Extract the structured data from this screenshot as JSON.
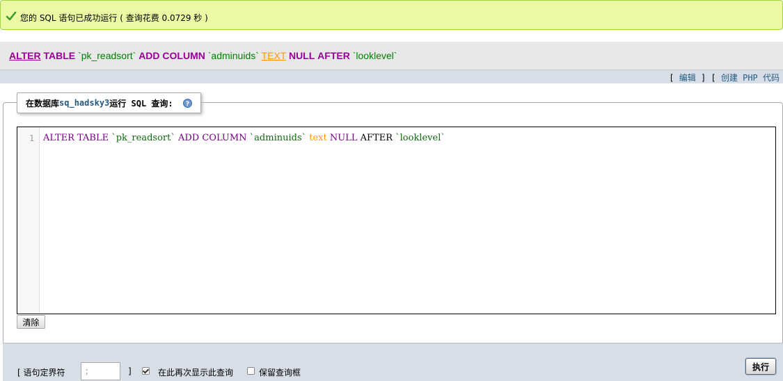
{
  "message": {
    "icon": "success-check-icon",
    "text": "您的 SQL 语句已成功运行 ( 查询花费 0.0729 秒 )"
  },
  "executed_sql": {
    "alter": "ALTER",
    "table": "TABLE",
    "table_name": "`pk_readsort`",
    "add": "ADD",
    "column": "COLUMN",
    "column_name": "`adminuids`",
    "type": "TEXT",
    "null": "NULL",
    "after": "AFTER",
    "after_column": "`looklevel`"
  },
  "links": {
    "open_bracket": "[",
    "edit": "编辑",
    "mid": "] [",
    "create_php": "创建 PHP 代码",
    "close_bracket": "]"
  },
  "query_box": {
    "legend_prefix": "在数据库",
    "database": "sq_hadsky3",
    "legend_suffix": "运行 SQL 查询:",
    "help_icon": "help-icon"
  },
  "editor": {
    "line_number": "1",
    "tokens": {
      "alter_table": "ALTER TABLE",
      "table_name": "`pk_readsort`",
      "add_column": "ADD COLUMN",
      "column_name": "`adminuids`",
      "type": "text",
      "null": "NULL",
      "after": "AFTER",
      "after_column": "`looklevel`"
    }
  },
  "buttons": {
    "clear": "清除",
    "go": "执行"
  },
  "options": {
    "delimiter_label": "[ 语句定界符",
    "delimiter_value": ";",
    "delimiter_close": "]",
    "show_query_label": "在此再次显示此查询",
    "show_query_checked": true,
    "keep_box_label": "保留查询框",
    "keep_box_checked": false
  },
  "colors": {
    "success_bg": "#ebf8a4",
    "keyword": "#990099",
    "string": "#008000",
    "type": "#ff9900",
    "link": "#235a81"
  }
}
